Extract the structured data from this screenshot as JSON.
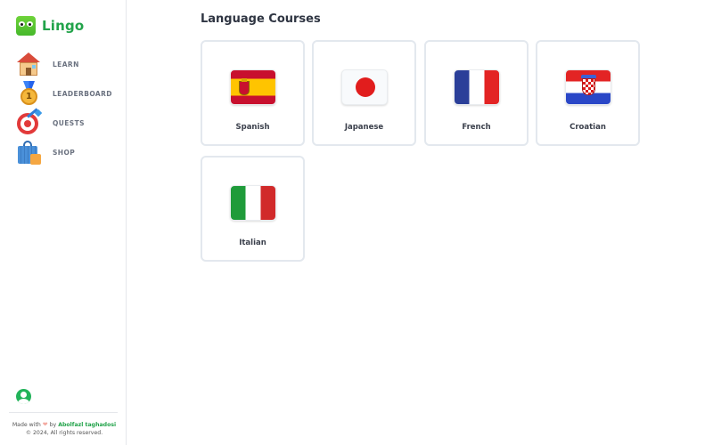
{
  "app": {
    "name": "Lingo"
  },
  "sidebar": {
    "items": [
      {
        "label": "LEARN",
        "icon": "house-icon"
      },
      {
        "label": "LEADERBOARD",
        "icon": "medal-icon"
      },
      {
        "label": "QUESTS",
        "icon": "target-icon"
      },
      {
        "label": "SHOP",
        "icon": "shopping-bag-icon"
      }
    ]
  },
  "footer": {
    "made_with": "Made with",
    "by": "by",
    "author": "Abolfazl taghadosi",
    "copyright": "© 2024, All rights reserved."
  },
  "main": {
    "title": "Language Courses",
    "courses": [
      {
        "name": "Spanish",
        "flag": "spain-flag"
      },
      {
        "name": "Japanese",
        "flag": "japan-flag"
      },
      {
        "name": "French",
        "flag": "france-flag"
      },
      {
        "name": "Croatian",
        "flag": "croatia-flag"
      },
      {
        "name": "Italian",
        "flag": "italy-flag"
      }
    ]
  },
  "colors": {
    "brand": "#22a34a",
    "card_border": "#e3e8ee",
    "text": "#3a3f4b"
  }
}
